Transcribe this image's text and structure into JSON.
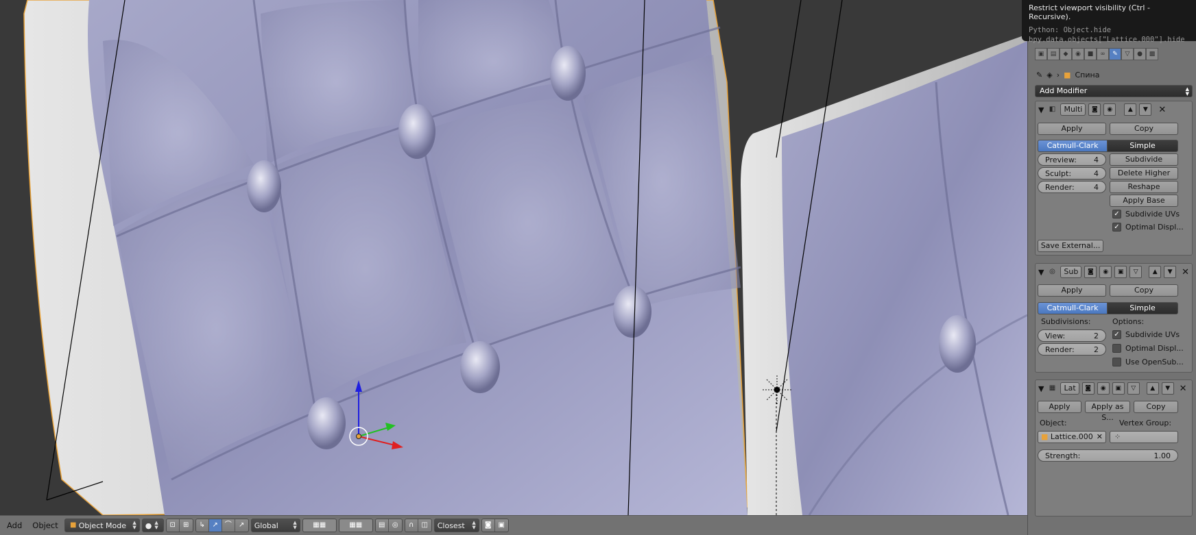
{
  "tooltip": {
    "title": "Restrict viewport visibility (Ctrl - Recursive).",
    "python1": "Python: Object.hide",
    "python2": "bpy.data.objects[\"Lattice.000\"].hide"
  },
  "header3d": {
    "menu_add": "Add",
    "menu_object": "Object",
    "mode": "Object Mode",
    "orientation": "Global",
    "snap": "Closest"
  },
  "breadcrumb": {
    "object_name": "Спина"
  },
  "add_modifier": "Add Modifier",
  "multires": {
    "name": "Multi",
    "apply": "Apply",
    "copy": "Copy",
    "catmull": "Catmull-Clark",
    "simple": "Simple",
    "preview_label": "Preview:",
    "preview_value": "4",
    "sculpt_label": "Sculpt:",
    "sculpt_value": "4",
    "render_label": "Render:",
    "render_value": "4",
    "subdivide": "Subdivide",
    "delete_higher": "Delete Higher",
    "reshape": "Reshape",
    "apply_base": "Apply Base",
    "subdivide_uvs": "Subdivide UVs",
    "optimal_display": "Optimal Displ...",
    "save_external": "Save External..."
  },
  "subsurf": {
    "name": "Sub",
    "apply": "Apply",
    "copy": "Copy",
    "catmull": "Catmull-Clark",
    "simple": "Simple",
    "subdivisions_label": "Subdivisions:",
    "options_label": "Options:",
    "view_label": "View:",
    "view_value": "2",
    "render_label": "Render:",
    "render_value": "2",
    "subdivide_uvs": "Subdivide UVs",
    "optimal_display": "Optimal Displ...",
    "use_opensubdiv": "Use OpenSub..."
  },
  "lattice": {
    "name": "Lat",
    "apply": "Apply",
    "apply_as_shape": "Apply as S...",
    "copy": "Copy",
    "object_label": "Object:",
    "vertex_group_label": "Vertex Group:",
    "object_value": "Lattice.000",
    "strength_label": "Strength:",
    "strength_value": "1.00"
  },
  "colors": {
    "accent": "#5680c2",
    "viewport_bg": "#393939",
    "panel_bg": "#727272",
    "selection_outline": "#e8a23a"
  }
}
